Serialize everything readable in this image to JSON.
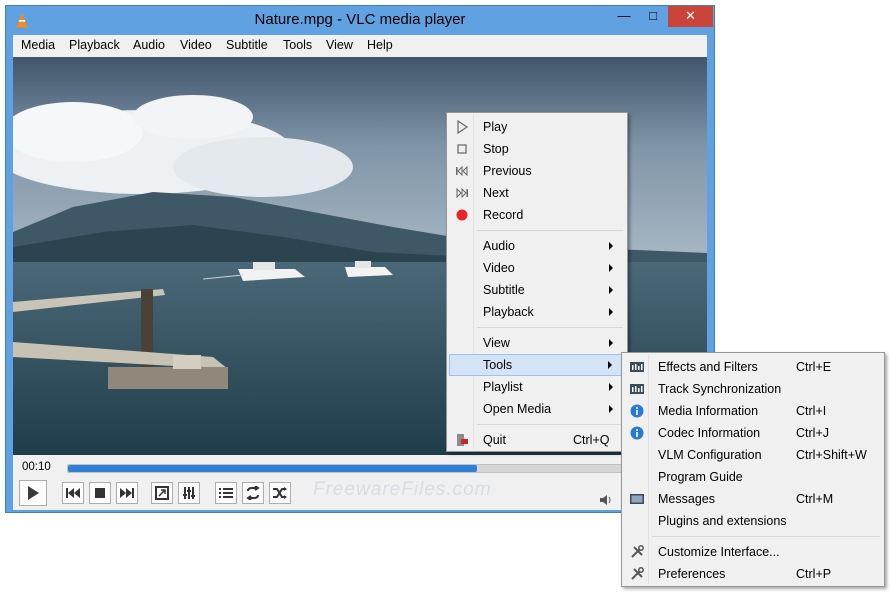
{
  "window": {
    "title": "Nature.mpg - VLC media player",
    "min_glyph": "—",
    "max_glyph": "□",
    "close_glyph": "✕"
  },
  "menubar": [
    "Media",
    "Playback",
    "Audio",
    "Video",
    "Subtitle",
    "Tools",
    "View",
    "Help"
  ],
  "player": {
    "elapsed": "00:10",
    "progress": 0.73,
    "watermark": "FreewareFiles.com"
  },
  "context_menu": {
    "play": "Play",
    "stop": "Stop",
    "previous": "Previous",
    "next": "Next",
    "record": "Record",
    "audio": "Audio",
    "video": "Video",
    "subtitle": "Subtitle",
    "playback": "Playback",
    "view": "View",
    "tools": "Tools",
    "playlist": "Playlist",
    "open_media": "Open Media",
    "quit": "Quit",
    "quit_shortcut": "Ctrl+Q"
  },
  "tools_menu": [
    {
      "label": "Effects and Filters",
      "shortcut": "Ctrl+E",
      "icon": "equalizer-icon"
    },
    {
      "label": "Track Synchronization",
      "shortcut": "",
      "icon": "equalizer-icon"
    },
    {
      "label": "Media Information",
      "shortcut": "Ctrl+I",
      "icon": "info-icon"
    },
    {
      "label": "Codec Information",
      "shortcut": "Ctrl+J",
      "icon": "info-icon"
    },
    {
      "label": "VLM Configuration",
      "shortcut": "Ctrl+Shift+W",
      "icon": ""
    },
    {
      "label": "Program Guide",
      "shortcut": "",
      "icon": ""
    },
    {
      "label": "Messages",
      "shortcut": "Ctrl+M",
      "icon": "terminal-icon"
    },
    {
      "label": "Plugins and extensions",
      "shortcut": "",
      "icon": ""
    },
    {
      "label": "Customize Interface...",
      "shortcut": "",
      "icon": "wrench-icon"
    },
    {
      "label": "Preferences",
      "shortcut": "Ctrl+P",
      "icon": "wrench-icon"
    }
  ],
  "colors": {
    "accent": "#2f7fd6",
    "titlebar": "#5fa1e1",
    "close": "#c9453a",
    "record": "#e8232b"
  }
}
